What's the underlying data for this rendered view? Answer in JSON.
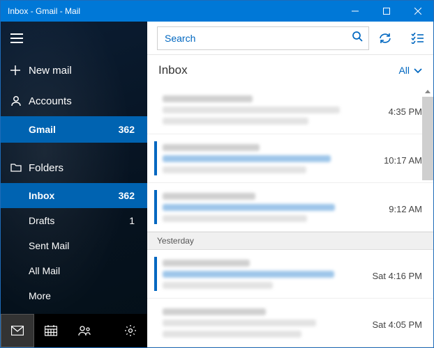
{
  "window": {
    "title": "Inbox - Gmail - Mail"
  },
  "sidebar": {
    "new_mail": "New mail",
    "accounts_label": "Accounts",
    "accounts": [
      {
        "name": "Gmail",
        "count": "362",
        "selected": true
      }
    ],
    "folders_label": "Folders",
    "folders": [
      {
        "name": "Inbox",
        "count": "362",
        "selected": true
      },
      {
        "name": "Drafts",
        "count": "1",
        "selected": false
      },
      {
        "name": "Sent Mail",
        "count": "",
        "selected": false
      },
      {
        "name": "All Mail",
        "count": "",
        "selected": false
      },
      {
        "name": "More",
        "count": "",
        "selected": false
      }
    ]
  },
  "search": {
    "placeholder": "Search"
  },
  "list": {
    "title": "Inbox",
    "filter": "All",
    "groups": [
      {
        "label": "",
        "messages": [
          {
            "time": "4:35 PM",
            "unread": false
          },
          {
            "time": "10:17 AM",
            "unread": true
          },
          {
            "time": "9:12 AM",
            "unread": true
          }
        ]
      },
      {
        "label": "Yesterday",
        "messages": [
          {
            "time": "Sat 4:16 PM",
            "unread": true
          },
          {
            "time": "Sat 4:05 PM",
            "unread": false
          }
        ]
      }
    ]
  }
}
